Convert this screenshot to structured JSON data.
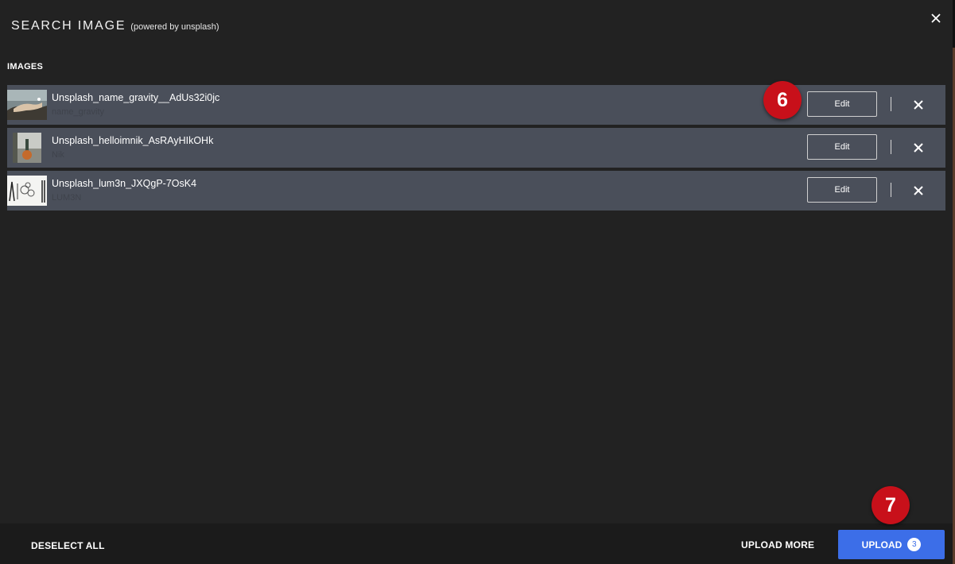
{
  "dialog": {
    "title": "SEARCH IMAGE",
    "subtitle": "(powered by unsplash)",
    "close_icon": "close-icon"
  },
  "section_label": "IMAGES",
  "images": [
    {
      "title": "Unsplash_name_gravity__AdUs32i0jc",
      "subtitle": "name_gravity",
      "edit_label": "Edit"
    },
    {
      "title": "Unsplash_helloimnik_AsRAyHIkOHk",
      "subtitle": "Nik",
      "edit_label": "Edit"
    },
    {
      "title": "Unsplash_lum3n_JXQgP-7OsK4",
      "subtitle": "LUM3N",
      "edit_label": "Edit"
    }
  ],
  "footer": {
    "deselect_label": "DESELECT ALL",
    "upload_more_label": "UPLOAD MORE",
    "upload_label": "UPLOAD",
    "upload_count": "3"
  },
  "step_markers": {
    "edit": "6",
    "upload": "7"
  },
  "colors": {
    "background": "#222222",
    "row": "#4a4f5a",
    "footer": "#1b1b1b",
    "primary": "#3c6ee8",
    "marker": "#c8101a"
  }
}
